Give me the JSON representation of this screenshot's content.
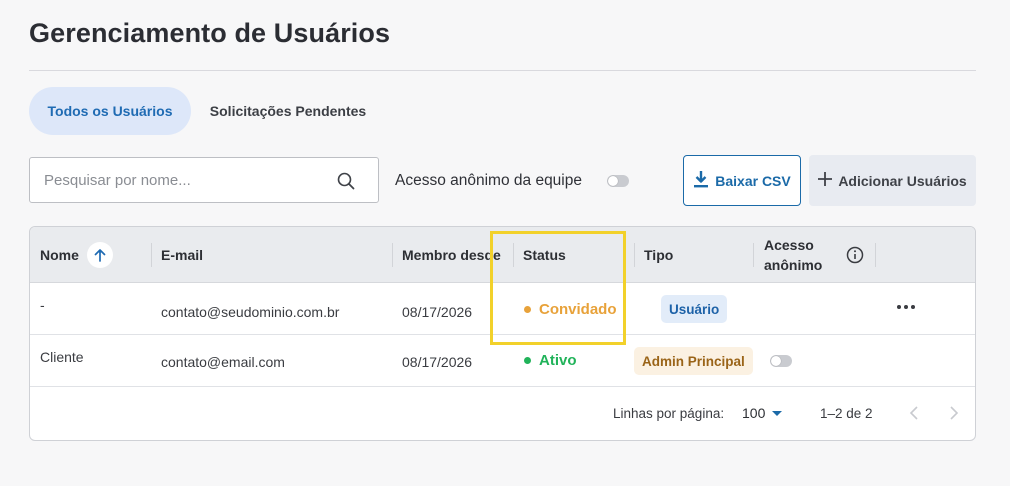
{
  "page": {
    "title": "Gerenciamento de Usuários"
  },
  "tabs": [
    {
      "label": "Todos os Usuários",
      "active": true
    },
    {
      "label": "Solicitações Pendentes",
      "active": false
    }
  ],
  "search": {
    "placeholder": "Pesquisar por nome...",
    "value": ""
  },
  "anonymous_access": {
    "label": "Acesso anônimo da equipe",
    "enabled": false
  },
  "actions": {
    "download_csv": "Baixar CSV",
    "add_users": "Adicionar Usuários"
  },
  "table": {
    "headers": {
      "name": "Nome",
      "email": "E-mail",
      "member_since": "Membro desde",
      "status": "Status",
      "type": "Tipo",
      "anon_line1": "Acesso",
      "anon_line2": "anônimo"
    },
    "rows": [
      {
        "name": "-",
        "email": "contato@seudominio.com.br",
        "member_since": "08/17/2026",
        "status": "Convidado",
        "status_color": "#e8a23a",
        "type": "Usuário"
      },
      {
        "name": "Cliente",
        "email": "contato@email.com",
        "member_since": "08/17/2026",
        "status": "Ativo",
        "status_color": "#21b35a",
        "type": "Admin Principal"
      }
    ]
  },
  "pagination": {
    "rows_per_page_label": "Linhas por página:",
    "rows_per_page": "100",
    "range": "1–2 de 2"
  },
  "colors": {
    "accent": "#1b6aa8",
    "tab_active_bg": "#dde7f9",
    "highlight": "#f2d12a"
  }
}
